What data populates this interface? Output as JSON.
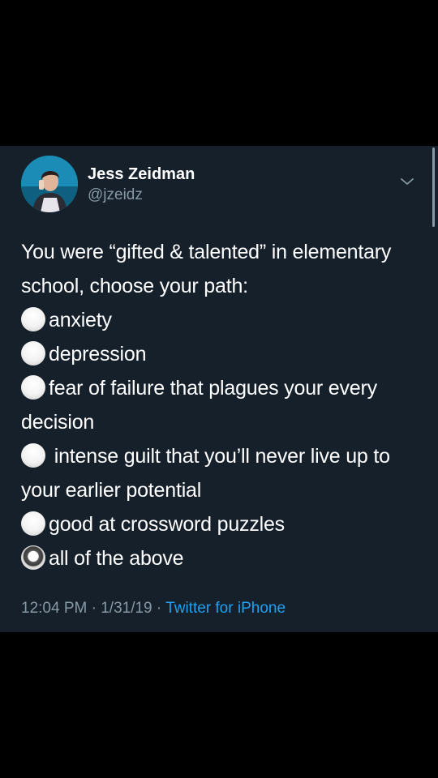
{
  "tweet": {
    "author": {
      "display_name": "Jess Zeidman",
      "handle": "@jzeidz"
    },
    "intro": "You were “gifted & talented” in elementary school, choose your path:",
    "options": [
      {
        "text": "anxiety",
        "selected": false
      },
      {
        "text": "depression",
        "selected": false
      },
      {
        "text": "fear of failure that plagues your every decision",
        "selected": false
      },
      {
        "text": " intense guilt that you’ll never live up to your earlier potential",
        "selected": false
      },
      {
        "text": "good at crossword puzzles",
        "selected": false
      },
      {
        "text": "all of the above",
        "selected": true
      }
    ],
    "meta": {
      "time": "12:04 PM",
      "separator": " · ",
      "date": "1/31/19",
      "source": "Twitter for iPhone"
    }
  },
  "icons": {
    "avatar": "profile-photo",
    "caret": "chevron-down-icon",
    "radio_empty": "radio-unchecked-icon",
    "radio_selected": "radio-checked-icon"
  },
  "colors": {
    "background": "#000000",
    "card": "#15202b",
    "text": "#ffffff",
    "secondary": "#8899a6",
    "link": "#1da1f2"
  }
}
